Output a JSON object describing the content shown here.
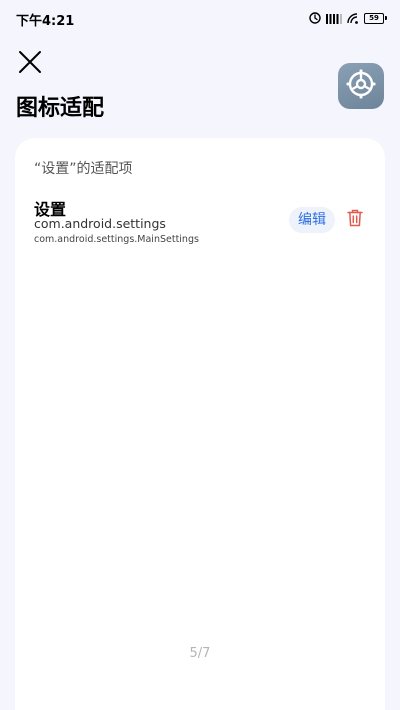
{
  "status_bar": {
    "time": "下午4:21",
    "battery_level": "59",
    "icons": [
      "alarm-icon",
      "signal-icon",
      "wifi-icon",
      "battery-icon"
    ]
  },
  "header": {
    "close_icon": "close-icon",
    "title": "图标适配",
    "app_icon": "settings-gear-icon"
  },
  "card": {
    "section_title": "“设置”的适配项",
    "items": [
      {
        "name": "设置",
        "package": "com.android.settings",
        "activity": "com.android.settings.MainSettings",
        "edit_label": "编辑",
        "delete_icon": "trash-icon"
      }
    ],
    "page_indicator": "5/7"
  },
  "colors": {
    "background": "#f5f5fd",
    "card": "#ffffff",
    "accent": "#2d6fe0",
    "delete": "#e25a4e",
    "app_icon": "#7b90a5"
  }
}
